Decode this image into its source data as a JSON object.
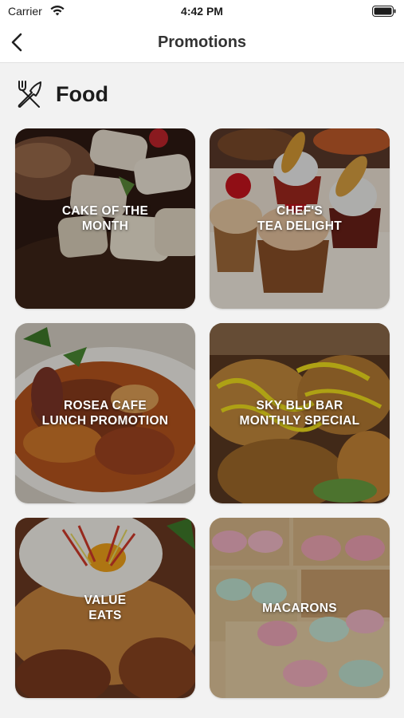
{
  "status_bar": {
    "carrier": "Carrier",
    "time": "4:42 PM"
  },
  "nav": {
    "title": "Promotions",
    "back_icon": "chevron-left-icon"
  },
  "section": {
    "label": "Food",
    "icon": "fork-knife-icon"
  },
  "promotions": [
    {
      "title": "CAKE OF THE\nMONTH"
    },
    {
      "title": "CHEF'S\nTEA DELIGHT"
    },
    {
      "title": "ROSEA CAFE\nLUNCH PROMOTION"
    },
    {
      "title": "SKY BLU BAR\nMONTHLY SPECIAL"
    },
    {
      "title": "VALUE\nEATS"
    },
    {
      "title": "MACARONS"
    }
  ]
}
